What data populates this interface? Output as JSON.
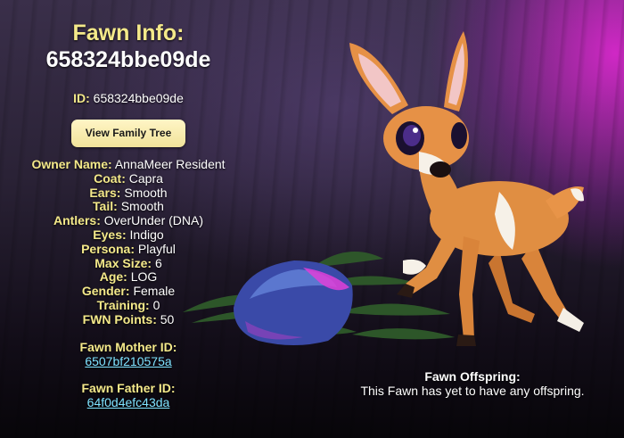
{
  "page": {
    "title_label": "Fawn Info:",
    "title_id": "658324bbe09de",
    "id_label": "ID:",
    "id_value": "658324bbe09de",
    "family_tree_button": "View Family Tree"
  },
  "stats": [
    {
      "label": "Owner Name:",
      "value": "AnnaMeer Resident"
    },
    {
      "label": "Coat:",
      "value": "Capra"
    },
    {
      "label": "Ears:",
      "value": "Smooth"
    },
    {
      "label": "Tail:",
      "value": "Smooth"
    },
    {
      "label": "Antlers:",
      "value": "OverUnder (DNA)"
    },
    {
      "label": "Eyes:",
      "value": "Indigo"
    },
    {
      "label": "Persona:",
      "value": "Playful"
    },
    {
      "label": "Max Size:",
      "value": "6"
    },
    {
      "label": "Age:",
      "value": "LOG"
    },
    {
      "label": "Gender:",
      "value": "Female"
    },
    {
      "label": "Training:",
      "value": "0"
    },
    {
      "label": "FWN Points:",
      "value": "50"
    }
  ],
  "parents": {
    "mother_label": "Fawn Mother ID:",
    "mother_id": "6507bf210575a",
    "father_label": "Fawn Father ID:",
    "father_id": "64f0d4efc43da"
  },
  "offspring": {
    "heading": "Fawn Offspring:",
    "text": "This Fawn has yet to have any offspring."
  },
  "colors": {
    "accent_label": "#f4e98a",
    "link": "#7fe3ff",
    "button_bg": "#f1e39a",
    "glow": "#e628dc"
  }
}
